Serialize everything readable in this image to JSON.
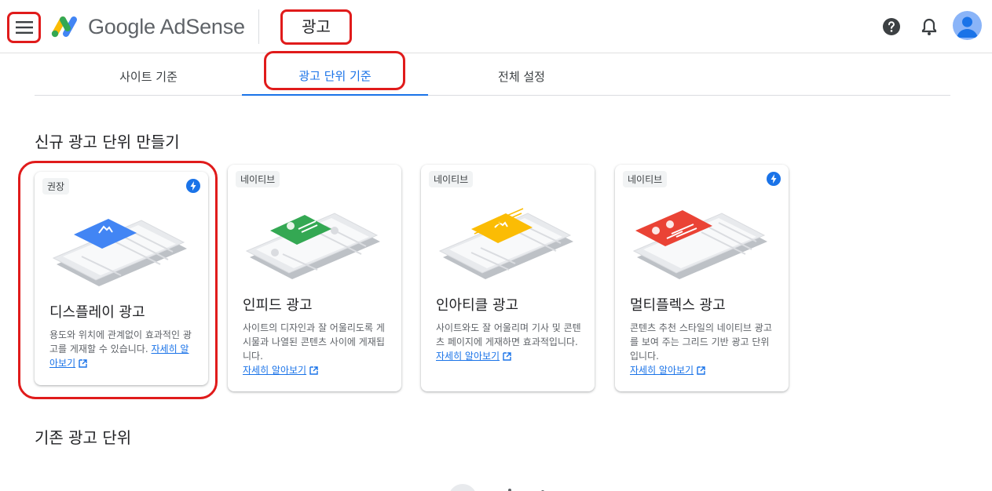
{
  "header": {
    "brand": "Google AdSense",
    "section_title": "광고",
    "icons": {
      "menu": "menu-icon",
      "help": "help-icon",
      "notifications": "bell-icon",
      "account": "avatar"
    }
  },
  "tabs": [
    {
      "label": "사이트 기준",
      "selected": false
    },
    {
      "label": "광고 단위 기준",
      "selected": true
    },
    {
      "label": "전체 설정",
      "selected": false
    }
  ],
  "create_section": {
    "heading": "신규 광고 단위 만들기"
  },
  "cards": [
    {
      "badge": "권장",
      "bolt": true,
      "title": "디스플레이 광고",
      "description": "용도와 위치에 관계없이 효과적인 광고를 게재할 수 있습니다.",
      "learn_more": "자세히 알아보기",
      "accent": "#4285f4"
    },
    {
      "badge": "네이티브",
      "bolt": false,
      "title": "인피드 광고",
      "description": "사이트의 디자인과 잘 어울리도록 게시물과 나열된 콘텐츠 사이에 게재됩니다.",
      "learn_more": "자세히 알아보기",
      "accent": "#34a853"
    },
    {
      "badge": "네이티브",
      "bolt": false,
      "title": "인아티클 광고",
      "description": "사이트와도 잘 어울리며 기사 및 콘텐츠 페이지에 게재하면 효과적입니다.",
      "learn_more": "자세히 알아보기",
      "accent": "#fbbc04"
    },
    {
      "badge": "네이티브",
      "bolt": true,
      "title": "멀티플렉스 광고",
      "description": "콘텐츠 추천 스타일의 네이티브 광고를 보여 주는 그리드 기반 광고 단위입니다.",
      "learn_more": "자세히 알아보기",
      "accent": "#ea4335"
    }
  ],
  "existing_section": {
    "heading": "기존 광고 단위"
  },
  "colors": {
    "accent_blue": "#1a73e8",
    "annotation_red": "#e01b1b",
    "google_blue": "#4285f4",
    "google_green": "#34a853",
    "google_yellow": "#fbbc04",
    "google_red": "#ea4335"
  }
}
